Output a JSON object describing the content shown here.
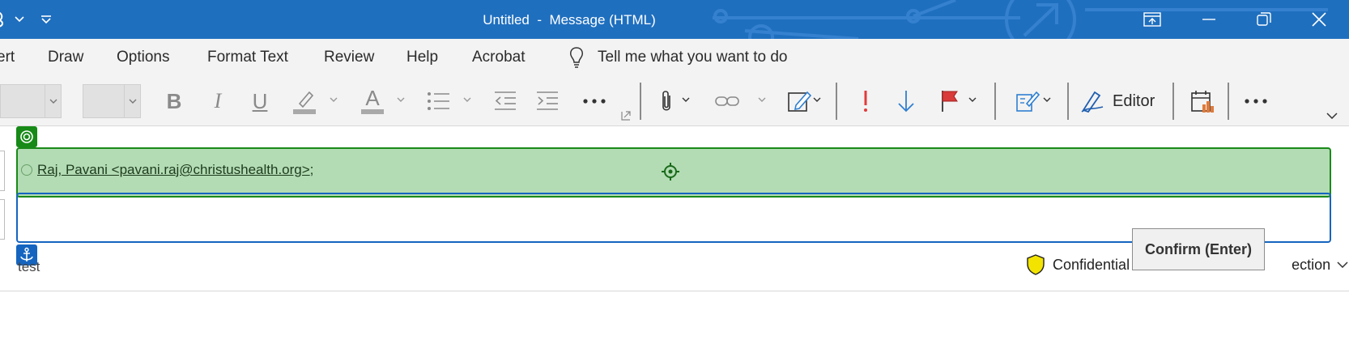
{
  "titlebar": {
    "title": "Untitled  -  Message (HTML)",
    "bg_color": "#1f6fbf",
    "icons": [
      "app-icon",
      "undo-dropdown-icon",
      "customize-quick-access-icon",
      "ribbon-display-options-icon",
      "minimize-icon",
      "restore-icon",
      "close-icon"
    ]
  },
  "tabs": {
    "items": [
      {
        "label": "ert"
      },
      {
        "label": "Draw"
      },
      {
        "label": "Options"
      },
      {
        "label": "Format Text"
      },
      {
        "label": "Review"
      },
      {
        "label": "Help"
      },
      {
        "label": "Acrobat"
      }
    ],
    "tell_me": "Tell me what you want to do"
  },
  "toolbar": {
    "bold": "B",
    "italic": "I",
    "underline": "U",
    "font_color_letter": "A",
    "editor_label": "Editor",
    "highlight_color": "#a9a9a9",
    "important_color": "#e23b3b",
    "low_importance_color": "#2f7fd1",
    "flag_color": "#d93a3a"
  },
  "message": {
    "to_recipient": "Raj, Pavani <pavani.raj@christushealth.org>",
    "to_separator": ";",
    "subject": "test",
    "sensitivity": "Confidential",
    "sensitivity_hidden_suffix": "ection"
  },
  "tooltip": {
    "text": "Confirm (Enter)"
  },
  "colors": {
    "to_fill": "#b3dcb4",
    "to_border": "#1a8a1a",
    "cc_border": "#1565c0",
    "shield": "#f2e400"
  }
}
